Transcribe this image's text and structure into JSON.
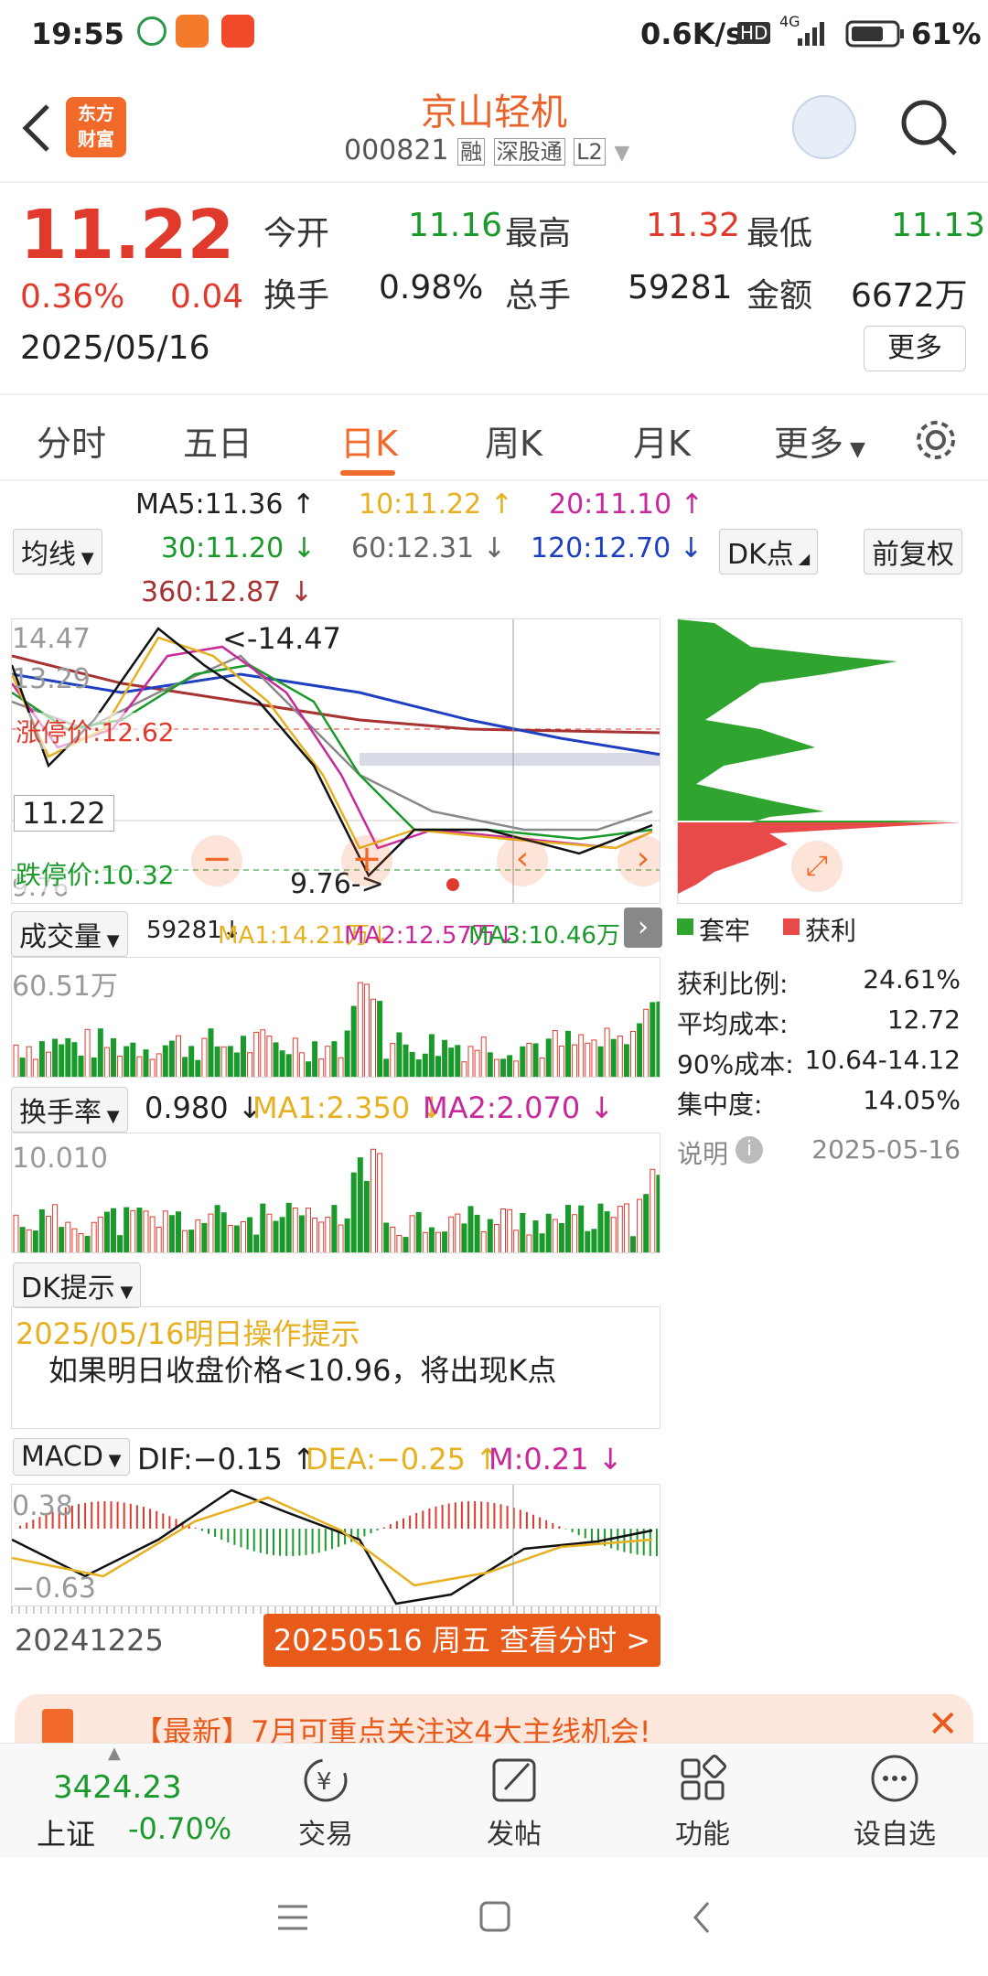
{
  "status": {
    "time": "19:55",
    "speed": "0.6K/s",
    "net": "4G",
    "battery": "61%"
  },
  "header": {
    "title": "京山轻机",
    "code": "000821",
    "tags": [
      "融",
      "深股通",
      "L2"
    ],
    "logo_line1": "东方",
    "logo_line2": "财富"
  },
  "quote": {
    "price": "11.22",
    "pct": "0.36%",
    "chg": "0.04",
    "date": "2025/05/16",
    "open_label": "今开",
    "open": "11.16",
    "high_label": "最高",
    "high": "11.32",
    "low_label": "最低",
    "low": "11.13",
    "turn_label": "换手",
    "turn": "0.98%",
    "vol_label": "总手",
    "vol": "59281",
    "amt_label": "金额",
    "amt": "6672万",
    "more_btn": "更多"
  },
  "tabs": [
    "分时",
    "五日",
    "日K",
    "周K",
    "月K",
    "更多"
  ],
  "ma": {
    "ma5": "MA5:11.36 ↑",
    "ma10": "10:11.22 ↑",
    "ma20": "20:11.10 ↑",
    "ma30": "30:11.20 ↓",
    "ma60": "60:12.31 ↓",
    "ma120": "120:12.70 ↓",
    "ma360": "360:12.87 ↓",
    "select": "均线",
    "dk": "DK点",
    "fq": "前复权"
  },
  "kline": {
    "top": "14.47",
    "mid": "13.29",
    "last": "11.22",
    "bottom": "9.76",
    "max_label": "<-14.47",
    "min_label": "9.76->",
    "limit_up": "涨停价:12.62",
    "limit_down": "跌停价:10.32"
  },
  "volume": {
    "select": "成交量",
    "value": "59281↓",
    "ma1": "MA1:14.21万↓",
    "ma2": "MA2:12.57万↓",
    "ma3": "MA3:10.46万↑",
    "top": "60.51万"
  },
  "turnover": {
    "select": "换手率",
    "value": "0.980 ↓",
    "ma1": "MA1:2.350 ↓",
    "ma2": "MA2:2.070 ↓",
    "top": "10.010"
  },
  "dk": {
    "select": "DK提示",
    "title": "2025/05/16明日操作提示",
    "text": "如果明日收盘价格<10.96，将出现K点"
  },
  "macd": {
    "select": "MACD",
    "dif": "DIF:−0.15 ↑",
    "dea": "DEA:−0.25 ↑",
    "m": "M:0.21 ↓",
    "top": "0.38",
    "bottom": "−0.63"
  },
  "timeline": {
    "start": "20241225",
    "button": "20250516 周五 查看分时 >"
  },
  "chips": {
    "legend1": "套牢",
    "legend2": "获利",
    "rows": [
      [
        "获利比例:",
        "24.61%"
      ],
      [
        "平均成本:",
        "12.72"
      ],
      [
        "90%成本:",
        "10.64-14.12"
      ],
      [
        "集中度:",
        "14.05%"
      ]
    ],
    "note": "说明",
    "note_date": "2025-05-16"
  },
  "banner": {
    "text": "【最新】7月可重点关注这4大主线机会!"
  },
  "bottom": {
    "index_val": "3424.23",
    "index_name": "上证",
    "index_pct": "-0.70%",
    "items": [
      "交易",
      "发帖",
      "功能",
      "设自选"
    ]
  },
  "colors": {
    "red": "#e03a2d",
    "green": "#1a9a2a",
    "orange": "#f26a2a"
  }
}
